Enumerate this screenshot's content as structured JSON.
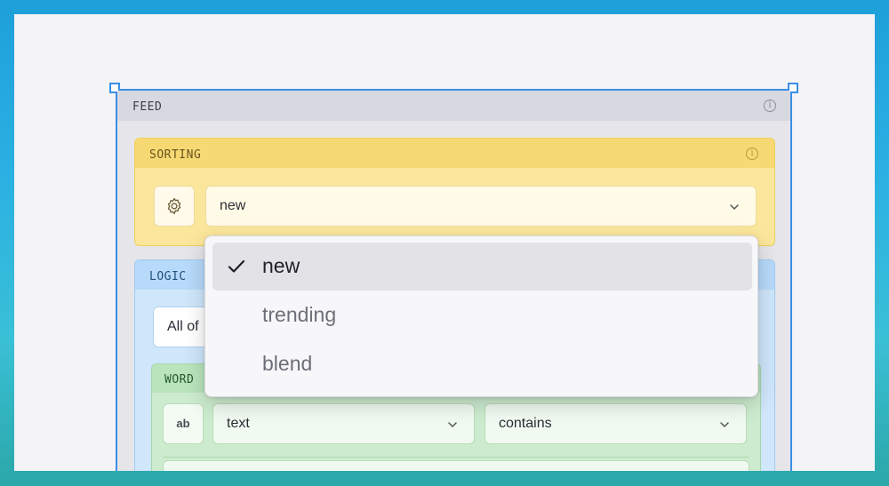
{
  "feed": {
    "title": "FEED"
  },
  "sorting": {
    "title": "SORTING",
    "selected_value": "new",
    "options": [
      {
        "label": "new",
        "selected": true
      },
      {
        "label": "trending",
        "selected": false
      },
      {
        "label": "blend",
        "selected": false
      }
    ]
  },
  "logic": {
    "title": "LOGIC",
    "mode_value": "All of"
  },
  "word": {
    "title": "WORD",
    "type_button_label": "ab",
    "field_value": "text",
    "operator_value": "contains"
  },
  "icons": {
    "info": "info-icon",
    "settings": "gear-icon",
    "expand": "chevron-down-icon",
    "selected": "check-icon"
  },
  "colors": {
    "selection_outline": "#3a8ee6",
    "sorting_bg": "#fbe79b",
    "logic_bg": "#cfe6fb",
    "word_bg": "#cdeccf"
  }
}
